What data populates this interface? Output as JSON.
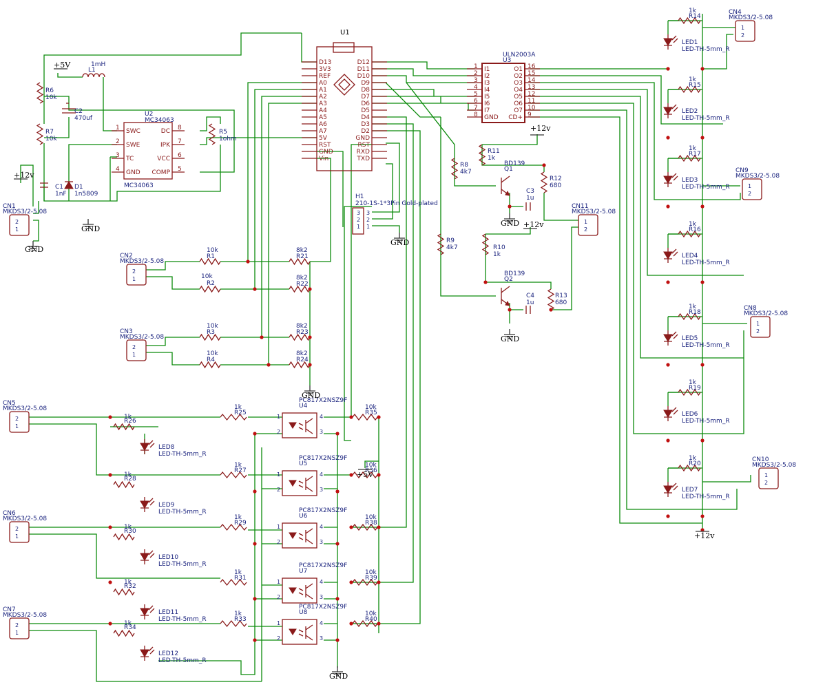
{
  "power": {
    "gnd": "GND",
    "v5": "+5V",
    "v12": "+12v"
  },
  "mcu": {
    "ref": "U1",
    "left_pins": [
      "D13",
      "3V3",
      "REF",
      "A0",
      "A1",
      "A2",
      "A3",
      "A4",
      "A5",
      "A6",
      "A7",
      "5V",
      "RST",
      "GND",
      "Vin"
    ],
    "right_pins": [
      "D12",
      "D11",
      "D10",
      "D9",
      "D8",
      "D7",
      "D6",
      "D5",
      "D4",
      "D3",
      "D2",
      "GND",
      "RST",
      "RXD",
      "TXD"
    ]
  },
  "uln": {
    "ref": "U3",
    "part": "ULN2003A",
    "left_pins": [
      "I1",
      "I2",
      "I3",
      "I4",
      "I5",
      "I6",
      "I7",
      "GND"
    ],
    "left_nums": [
      "1",
      "2",
      "3",
      "4",
      "5",
      "6",
      "7",
      "8"
    ],
    "right_pins": [
      "O1",
      "O2",
      "O3",
      "O4",
      "O5",
      "O6",
      "O7",
      "CD+"
    ],
    "right_nums": [
      "16",
      "15",
      "14",
      "13",
      "12",
      "11",
      "10",
      "9"
    ]
  },
  "regulator": {
    "ref": "U2",
    "part": "MC34063",
    "part2": "MC34063",
    "left_pins": [
      "SWC",
      "SWE",
      "TC",
      "GND"
    ],
    "left_nums": [
      "1",
      "2",
      "3",
      "4"
    ],
    "right_pins": [
      "DC",
      "IPK",
      "VCC",
      "COMP"
    ],
    "right_nums": [
      "8",
      "7",
      "6",
      "5"
    ],
    "r6": "R6",
    "r6v": "10k",
    "r7": "R7",
    "r7v": "10k",
    "c2": "C2",
    "c2v": "470uf",
    "l1": "L1",
    "l1v": "1mH",
    "r5": "R5",
    "r5v": "1ohm",
    "c1": "C1",
    "c1v": "1nF",
    "d1": "D1",
    "d1v": "1n5809"
  },
  "connectors": {
    "cn1": {
      "ref": "CN1",
      "part": "MKDS3/2-5.08"
    },
    "cn2": {
      "ref": "CN2",
      "part": "MKDS3/2-5.08"
    },
    "cn3": {
      "ref": "CN3",
      "part": "MKDS3/2-5.08"
    },
    "cn4": {
      "ref": "CN4",
      "part": "MKDS3/2-5.08"
    },
    "cn5": {
      "ref": "CN5",
      "part": "MKDS3/2-5.08"
    },
    "cn6": {
      "ref": "CN6",
      "part": "MKDS3/2-5.08"
    },
    "cn7": {
      "ref": "CN7",
      "part": "MKDS3/2-5.08"
    },
    "cn8": {
      "ref": "CN8",
      "part": "MKDS3/2-5.08"
    },
    "cn9": {
      "ref": "CN9",
      "part": "MKDS3/2-5.08"
    },
    "cn10": {
      "ref": "CN10",
      "part": "MKDS3/2-5.08"
    },
    "cn11": {
      "ref": "CN11",
      "part": "MKDS3/2-5.08"
    },
    "pin1": "1",
    "pin2": "2",
    "pin3": "3"
  },
  "header": {
    "ref": "H1",
    "part": "210-1S-1*3Pin Gold-plated"
  },
  "inputs": {
    "r1": "R1",
    "r1v": "10k",
    "r2": "R2",
    "r2v": "10k",
    "r3": "R3",
    "r3v": "10k",
    "r4": "R4",
    "r4v": "10k",
    "r21": "R21",
    "r22": "R22",
    "r23": "R23",
    "r24": "R24",
    "rv": "8k2"
  },
  "transistors": {
    "q1": "Q1",
    "q2": "Q2",
    "qpart": "BD139",
    "r8": "R8",
    "r8v": "4k7",
    "r9": "R9",
    "r9v": "4k7",
    "r10": "R10",
    "r10v": "1k",
    "r11": "R11",
    "r11v": "1k",
    "r12": "R12",
    "r12v": "680",
    "r13": "R13",
    "r13v": "680",
    "c3": "C3",
    "c4": "C4",
    "cv": "1u"
  },
  "leds_out": {
    "rv": "1k",
    "part": "LED-TH-5mm_R",
    "items": [
      {
        "r": "R14",
        "led": "LED1"
      },
      {
        "r": "R15",
        "led": "LED2"
      },
      {
        "r": "R17",
        "led": "LED3"
      },
      {
        "r": "R16",
        "led": "LED4"
      },
      {
        "r": "R18",
        "led": "LED5"
      },
      {
        "r": "R19",
        "led": "LED6"
      },
      {
        "r": "R20",
        "led": "LED7"
      }
    ]
  },
  "opto": {
    "part": "PC817X2NSZ9F",
    "rv": "1k",
    "rpv": "10k",
    "ledpart": "LED-TH-5mm_R",
    "items": [
      {
        "u": "U4",
        "ra": "R25",
        "rb": "R26",
        "rp": "R35",
        "led": "LED8"
      },
      {
        "u": "U5",
        "ra": "R27",
        "rb": "R28",
        "rp": "R36",
        "led": "LED9"
      },
      {
        "u": "U6",
        "ra": "R29",
        "rb": "R30",
        "rp": "R38",
        "led": "LED10"
      },
      {
        "u": "U7",
        "ra": "R31",
        "rb": "R32",
        "rp": "R39",
        "led": "LED11"
      },
      {
        "u": "U8",
        "ra": "R33",
        "rb": "R34",
        "rp": "R40",
        "led": "LED12"
      }
    ],
    "pins": [
      "1",
      "2",
      "3",
      "4"
    ]
  }
}
